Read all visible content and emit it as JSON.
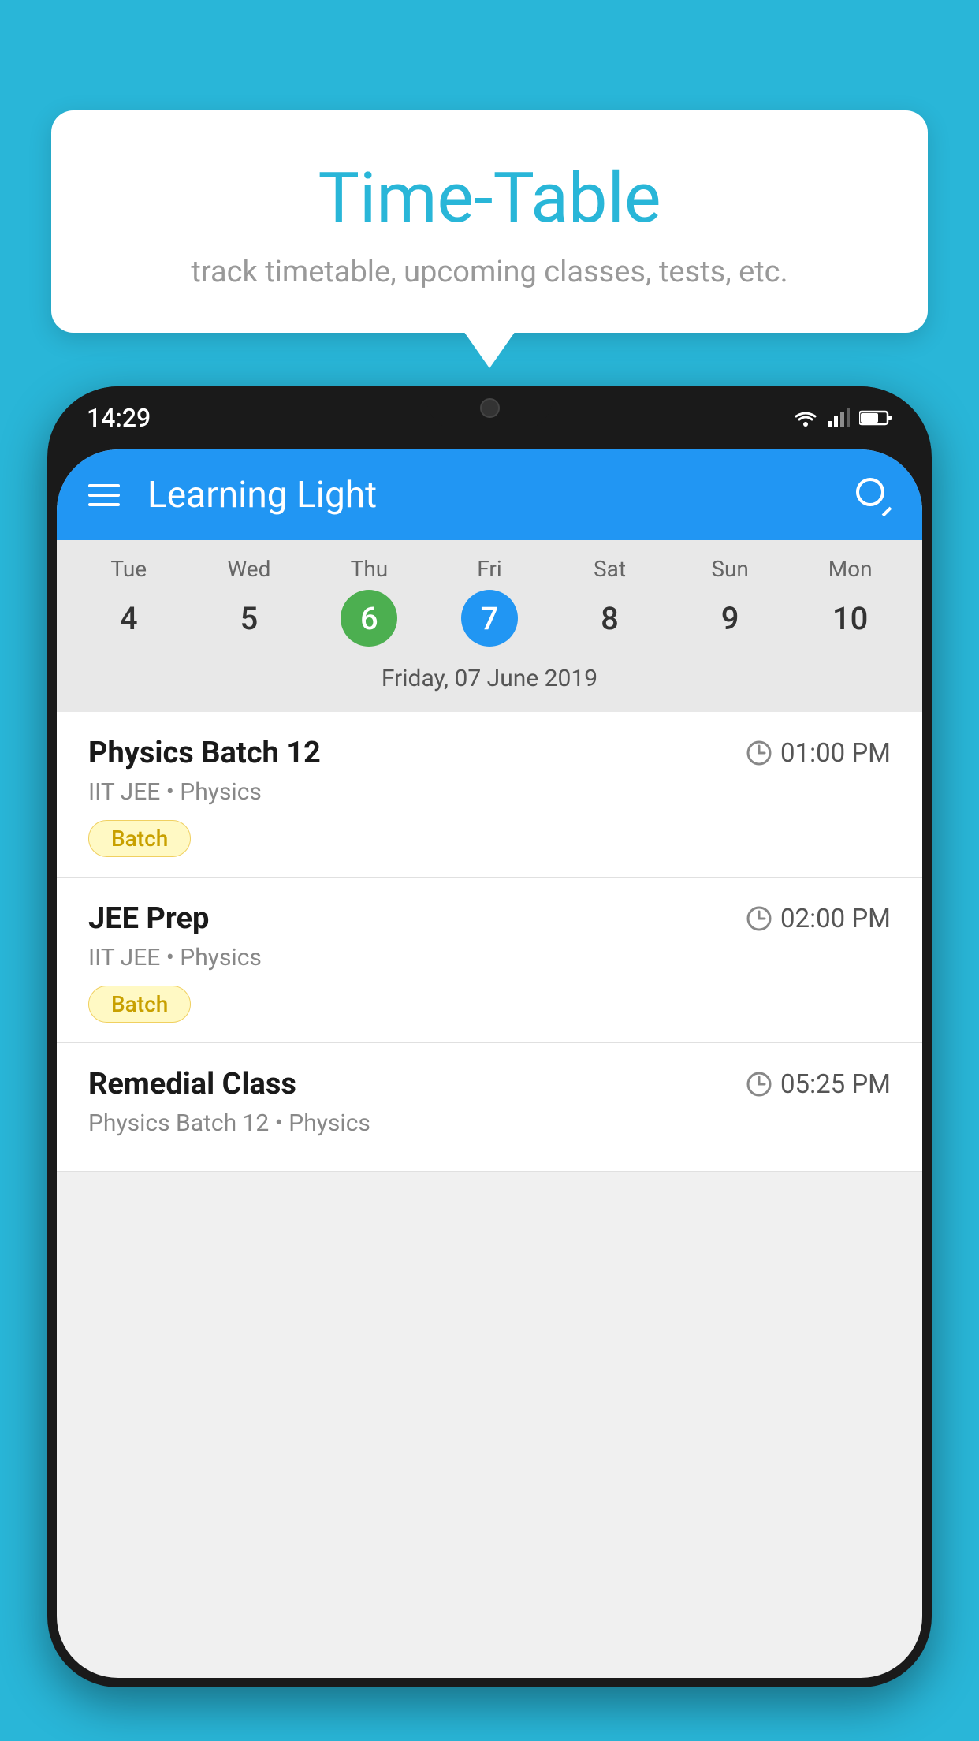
{
  "background_color": "#29B6D8",
  "tooltip": {
    "title": "Time-Table",
    "subtitle": "track timetable, upcoming classes, tests, etc."
  },
  "phone": {
    "status_time": "14:29",
    "app_title": "Learning Light",
    "calendar": {
      "days": [
        {
          "name": "Tue",
          "num": "4",
          "state": "normal"
        },
        {
          "name": "Wed",
          "num": "5",
          "state": "normal"
        },
        {
          "name": "Thu",
          "num": "6",
          "state": "today"
        },
        {
          "name": "Fri",
          "num": "7",
          "state": "selected"
        },
        {
          "name": "Sat",
          "num": "8",
          "state": "normal"
        },
        {
          "name": "Sun",
          "num": "9",
          "state": "normal"
        },
        {
          "name": "Mon",
          "num": "10",
          "state": "normal"
        }
      ],
      "selected_date_label": "Friday, 07 June 2019"
    },
    "schedule": [
      {
        "title": "Physics Batch 12",
        "time": "01:00 PM",
        "meta": "IIT JEE • Physics",
        "tag": "Batch"
      },
      {
        "title": "JEE Prep",
        "time": "02:00 PM",
        "meta": "IIT JEE • Physics",
        "tag": "Batch"
      },
      {
        "title": "Remedial Class",
        "time": "05:25 PM",
        "meta": "Physics Batch 12 • Physics",
        "tag": ""
      }
    ]
  }
}
